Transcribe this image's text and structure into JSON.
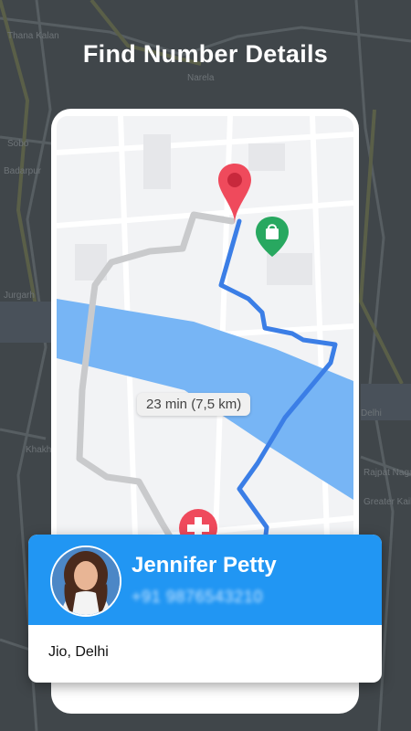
{
  "headline": "Find Number Details",
  "map": {
    "route_label": "23 min (7,5 km)",
    "background_places": [
      "Thana Kalan",
      "Narela",
      "Sobo",
      "Badarpur",
      "Khakhl Nahar",
      "Delhi",
      "Rajpat Nagar",
      "Greater Kailash",
      "Jurgarh"
    ],
    "icons": [
      "location-pin-icon",
      "shopping-bag-icon",
      "hospital-icon"
    ]
  },
  "contact": {
    "name": "Jennifer Petty",
    "phone": "+91 9876543210",
    "location": "Jio, Delhi"
  },
  "colors": {
    "accent_blue": "#2196f3",
    "route_blue": "#3b7ee6",
    "river_blue": "#77b5f5",
    "pin_red": "#ef4a5c",
    "bag_green": "#28a860"
  }
}
